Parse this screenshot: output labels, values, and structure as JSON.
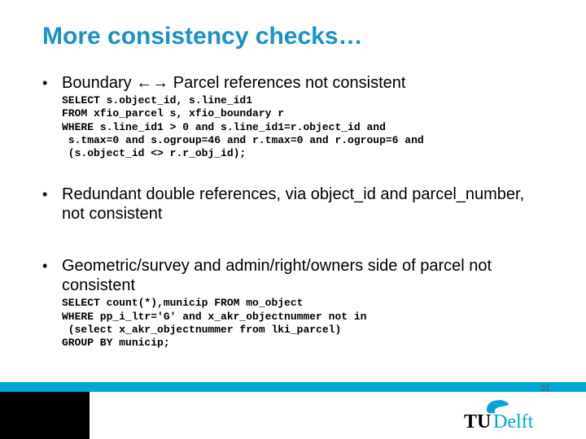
{
  "title": "More consistency checks…",
  "bullets": [
    {
      "text": "Boundary ←→ Parcel references not consistent",
      "code": "SELECT s.object_id, s.line_id1\nFROM xfio_parcel s, xfio_boundary r\nWHERE s.line_id1 > 0 and s.line_id1=r.object_id and\n s.tmax=0 and s.ogroup=46 and r.tmax=0 and r.ogroup=6 and\n (s.object_id <> r.r_obj_id);"
    },
    {
      "text": "Redundant double references, via object_id and parcel_number, not consistent",
      "code": ""
    },
    {
      "text": "Geometric/survey and admin/right/owners side of parcel not consistent",
      "code": "SELECT count(*),municip FROM mo_object\nWHERE pp_i_ltr='G' and x_akr_objectnummer not in\n (select x_akr_objectnummer from lki_parcel)\nGROUP BY municip;"
    }
  ],
  "page_number": "31",
  "logo_text": {
    "tu": "TU",
    "delft": "Delft"
  },
  "colors": {
    "accent": "#00a6d6",
    "title": "#1992c8"
  }
}
